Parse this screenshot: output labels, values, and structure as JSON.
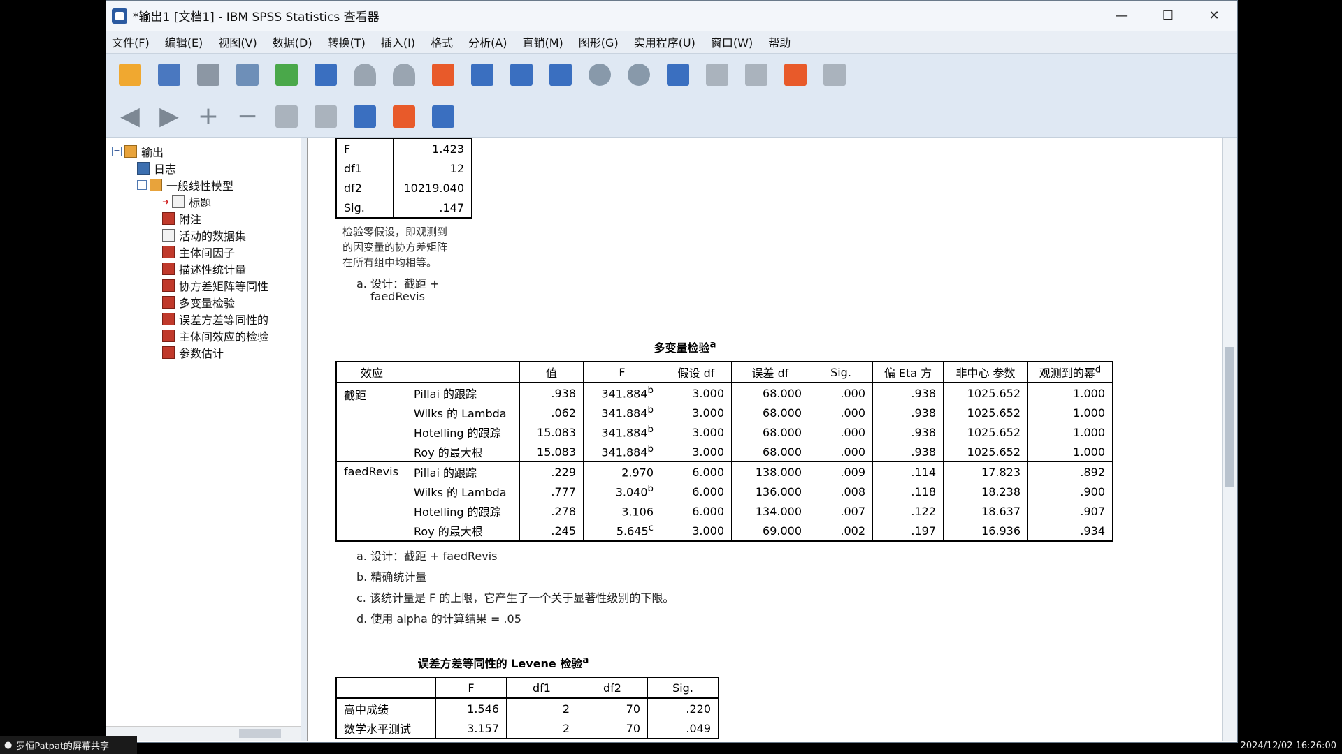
{
  "window": {
    "title": "*输出1 [文档1] - IBM SPSS Statistics 查看器",
    "minimize": "—",
    "maximize": "☐",
    "close": "✕"
  },
  "menu": [
    "文件(F)",
    "编辑(E)",
    "视图(V)",
    "数据(D)",
    "转换(T)",
    "插入(I)",
    "格式",
    "分析(A)",
    "直销(M)",
    "图形(G)",
    "实用程序(U)",
    "窗口(W)",
    "帮助"
  ],
  "nav": {
    "items": [
      {
        "label": "输出",
        "icon": "book",
        "level": 0,
        "expander": "−"
      },
      {
        "label": "日志",
        "icon": "log",
        "level": 1
      },
      {
        "label": "一般线性模型",
        "icon": "book",
        "level": 1,
        "expander": "−"
      },
      {
        "label": "标题",
        "icon": "note",
        "level": 2,
        "current": true
      },
      {
        "label": "附注",
        "icon": "table",
        "level": 2
      },
      {
        "label": "活动的数据集",
        "icon": "note",
        "level": 2
      },
      {
        "label": "主体间因子",
        "icon": "table",
        "level": 2
      },
      {
        "label": "描述性统计量",
        "icon": "table",
        "level": 2
      },
      {
        "label": "协方差矩阵等同性",
        "icon": "table",
        "level": 2
      },
      {
        "label": "多变量检验",
        "icon": "table",
        "level": 2
      },
      {
        "label": "误差方差等同性的",
        "icon": "table",
        "level": 2
      },
      {
        "label": "主体间效应的检验",
        "icon": "table",
        "level": 2
      },
      {
        "label": "参数估计",
        "icon": "table",
        "level": 2
      }
    ]
  },
  "box_table": {
    "rows": [
      {
        "label": "F",
        "value": "1.423"
      },
      {
        "label": "df1",
        "value": "12"
      },
      {
        "label": "df2",
        "value": "10219.040"
      },
      {
        "label": "Sig.",
        "value": ".147"
      }
    ],
    "note1": "检验零假设，即观测到",
    "note2": "的因变量的协方差矩阵",
    "note3": "在所有组中均相等。",
    "note_a1": "a. 设计：截距 +",
    "note_a2": "faedRevis"
  },
  "multivariate": {
    "title": "多变量检验",
    "title_sup": "a",
    "headers": [
      "效应",
      "",
      "值",
      "F",
      "假设 df",
      "误差 df",
      "Sig.",
      "偏 Eta 方",
      "非中心 参数",
      "观测到的幂"
    ],
    "header_sup_last": "d",
    "groups": [
      {
        "effect": "截距",
        "rows": [
          {
            "test": "Pillai 的跟踪",
            "value": ".938",
            "F": "341.884",
            "F_sup": "b",
            "hyp_df": "3.000",
            "err_df": "68.000",
            "sig": ".000",
            "eta": ".938",
            "nc": "1025.652",
            "power": "1.000"
          },
          {
            "test": "Wilks 的 Lambda",
            "value": ".062",
            "F": "341.884",
            "F_sup": "b",
            "hyp_df": "3.000",
            "err_df": "68.000",
            "sig": ".000",
            "eta": ".938",
            "nc": "1025.652",
            "power": "1.000"
          },
          {
            "test": "Hotelling 的跟踪",
            "value": "15.083",
            "F": "341.884",
            "F_sup": "b",
            "hyp_df": "3.000",
            "err_df": "68.000",
            "sig": ".000",
            "eta": ".938",
            "nc": "1025.652",
            "power": "1.000"
          },
          {
            "test": "Roy 的最大根",
            "value": "15.083",
            "F": "341.884",
            "F_sup": "b",
            "hyp_df": "3.000",
            "err_df": "68.000",
            "sig": ".000",
            "eta": ".938",
            "nc": "1025.652",
            "power": "1.000"
          }
        ]
      },
      {
        "effect": "faedRevis",
        "rows": [
          {
            "test": "Pillai 的跟踪",
            "value": ".229",
            "F": "2.970",
            "F_sup": "",
            "hyp_df": "6.000",
            "err_df": "138.000",
            "sig": ".009",
            "eta": ".114",
            "nc": "17.823",
            "power": ".892"
          },
          {
            "test": "Wilks 的 Lambda",
            "value": ".777",
            "F": "3.040",
            "F_sup": "b",
            "hyp_df": "6.000",
            "err_df": "136.000",
            "sig": ".008",
            "eta": ".118",
            "nc": "18.238",
            "power": ".900"
          },
          {
            "test": "Hotelling 的跟踪",
            "value": ".278",
            "F": "3.106",
            "F_sup": "",
            "hyp_df": "6.000",
            "err_df": "134.000",
            "sig": ".007",
            "eta": ".122",
            "nc": "18.637",
            "power": ".907"
          },
          {
            "test": "Roy 的最大根",
            "value": ".245",
            "F": "5.645",
            "F_sup": "c",
            "hyp_df": "3.000",
            "err_df": "69.000",
            "sig": ".002",
            "eta": ".197",
            "nc": "16.936",
            "power": ".934"
          }
        ]
      }
    ],
    "footnotes": [
      "a. 设计：截距 + faedRevis",
      "b. 精确统计量",
      "c. 该统计量是 F 的上限，它产生了一个关于显著性级别的下限。",
      "d. 使用 alpha 的计算结果 = .05"
    ]
  },
  "levene": {
    "title": "误差方差等同性的 Levene 检验",
    "title_sup": "a",
    "headers": [
      "",
      "F",
      "df1",
      "df2",
      "Sig."
    ],
    "rows": [
      {
        "label": "高中成绩",
        "F": "1.546",
        "df1": "2",
        "df2": "70",
        "sig": ".220"
      },
      {
        "label": "数学水平测试",
        "F": "3.157",
        "df1": "2",
        "df2": "70",
        "sig": ".049"
      }
    ]
  },
  "taskbar": {
    "share_label": "罗恒Patpat的屏幕共享",
    "datetime": "2024/12/02 16:26:00"
  }
}
